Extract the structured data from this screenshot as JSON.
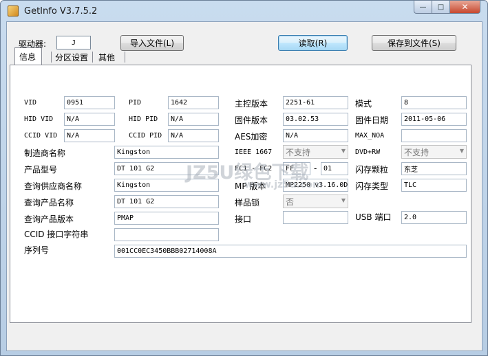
{
  "window": {
    "title": "GetInfo V3.7.5.2",
    "icon": "app-icon",
    "controls": {
      "minimize": "—",
      "maximize": "□",
      "close": "✕"
    }
  },
  "toolbar": {
    "drive_label": "驱动器:",
    "drive_value": "J",
    "import_button": "导入文件(L)",
    "read_button": "读取(R)",
    "save_button": "保存到文件(S)"
  },
  "tabs": [
    {
      "label": "信息",
      "active": true
    },
    {
      "label": "分区设置",
      "active": false
    },
    {
      "label": "其他",
      "active": false
    }
  ],
  "info": {
    "vid_label": "VID",
    "vid_value": "0951",
    "pid_label": "PID",
    "pid_value": "1642",
    "hid_vid_label": "HID VID",
    "hid_vid_value": "N/A",
    "hid_pid_label": "HID PID",
    "hid_pid_value": "N/A",
    "ccid_vid_label": "CCID VID",
    "ccid_vid_value": "N/A",
    "ccid_pid_label": "CCID PID",
    "ccid_pid_value": "N/A",
    "vendor_label": "制造商名称",
    "vendor_value": "Kingston",
    "product_label": "产品型号",
    "product_value": "DT 101 G2",
    "query_vendor_label": "查询供应商名称",
    "query_vendor_value": "Kingston",
    "query_product_label": "查询产品名称",
    "query_product_value": "DT 101 G2",
    "query_rev_label": "查询产品版本",
    "query_rev_value": "PMAP",
    "ccid_str_label": "CCID 接口字符串",
    "ccid_str_value": "",
    "serial_label": "序列号",
    "serial_value": "001CC0EC3450BBB02714008A",
    "ctrl_ver_label": "主控版本",
    "ctrl_ver_value": "2251-61",
    "fw_ver_label": "固件版本",
    "fw_ver_value": "03.02.53",
    "aes_label": "AES加密",
    "aes_value": "N/A",
    "ieee_label": "IEEE 1667",
    "ieee_value": "不支持",
    "fc_label": "FC1 - FC2",
    "fc1_value": "FF",
    "fc_dash": "-",
    "fc2_value": "01",
    "mp_ver_label": "MP 版本",
    "mp_ver_value": "MP2250 v3.16.0D",
    "sample_lock_label": "样品锁",
    "sample_lock_value": "否",
    "interface_label": "接口",
    "interface_value": "",
    "mode_label": "模式",
    "mode_value": "8",
    "fw_date_label": "固件日期",
    "fw_date_value": "2011-05-06",
    "max_noa_label": "MAX_NOA",
    "max_noa_value": "",
    "dvdrw_label": "DVD+RW",
    "dvdrw_value": "不支持",
    "flash_chip_label": "闪存颗粒",
    "flash_chip_value": "东芝",
    "flash_type_label": "闪存类型",
    "flash_type_value": "TLC",
    "usb_port_label": "USB 端口",
    "usb_port_value": "2.0"
  },
  "watermark": {
    "main": "JZ5U绿色下载",
    "sub": "www.jz5u.com"
  }
}
